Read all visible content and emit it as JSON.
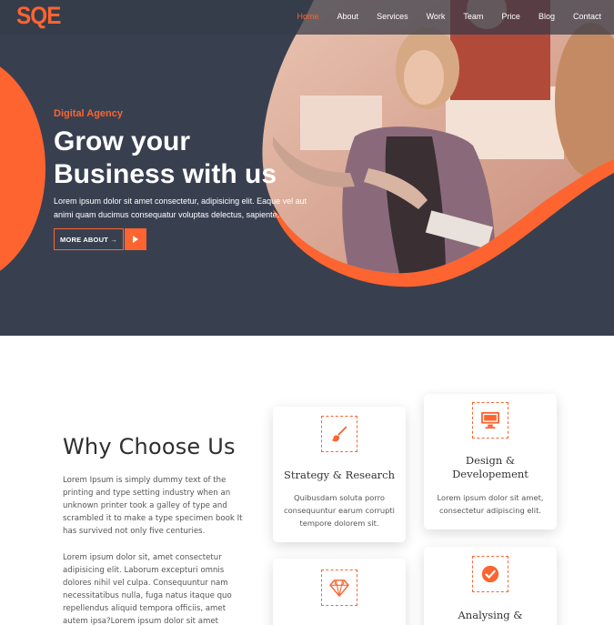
{
  "navbar": {
    "logo": "SQE",
    "links": [
      "Home",
      "About",
      "Services",
      "Work",
      "Team",
      "Price",
      "Blog",
      "Contact"
    ],
    "active": "Home"
  },
  "hero": {
    "eyebrow": "Digital Agency",
    "headline_line1": "Grow your",
    "headline_line2": "Business with us",
    "lead": "Lorem ipsum dolor sit amet consectetur, adipisicing elit. Eaque vel aut animi quam ducimus consequatur voluptas delectus, sapiente.",
    "more_about_label": "MORE ABOUT →"
  },
  "why": {
    "title": "Why Choose Us",
    "paragraph1": "Lorem Ipsum is simply dummy text of the printing and type setting industry when an unknown printer took a galley of type and scrambled it to make a type specimen book It has survived not only five centuries.",
    "paragraph2": "Lorem ipsum dolor sit, amet consectetur adipisicing elit. Laborum excepturi omnis dolores nihil vel culpa. Consequuntur nam necessitatibus nulla, fuga natus itaque quo repellendus aliquid tempora officiis, amet autem ipsa?Lorem ipsum dolor sit amet consectetur adipisicing elit. Mollitia, eaque quisquam! Maiores"
  },
  "cards": [
    {
      "icon": "paintbrush-icon",
      "title": "Strategy & Research",
      "text": "Quibusdam soluta porro consequuntur earum corrupti tempore dolorem sit."
    },
    {
      "icon": "monitor-icon",
      "title_line1": "Design &",
      "title_line2": "Developement",
      "text": "Lorem ipsum dolor sit amet, consectetur adipiscing elit."
    },
    {
      "icon": "diamond-icon"
    },
    {
      "icon": "check-circle-icon",
      "title": "Analysing &"
    }
  ],
  "colors": {
    "accent": "#fd6430",
    "hero_bg": "#384050",
    "text": "#333333"
  }
}
